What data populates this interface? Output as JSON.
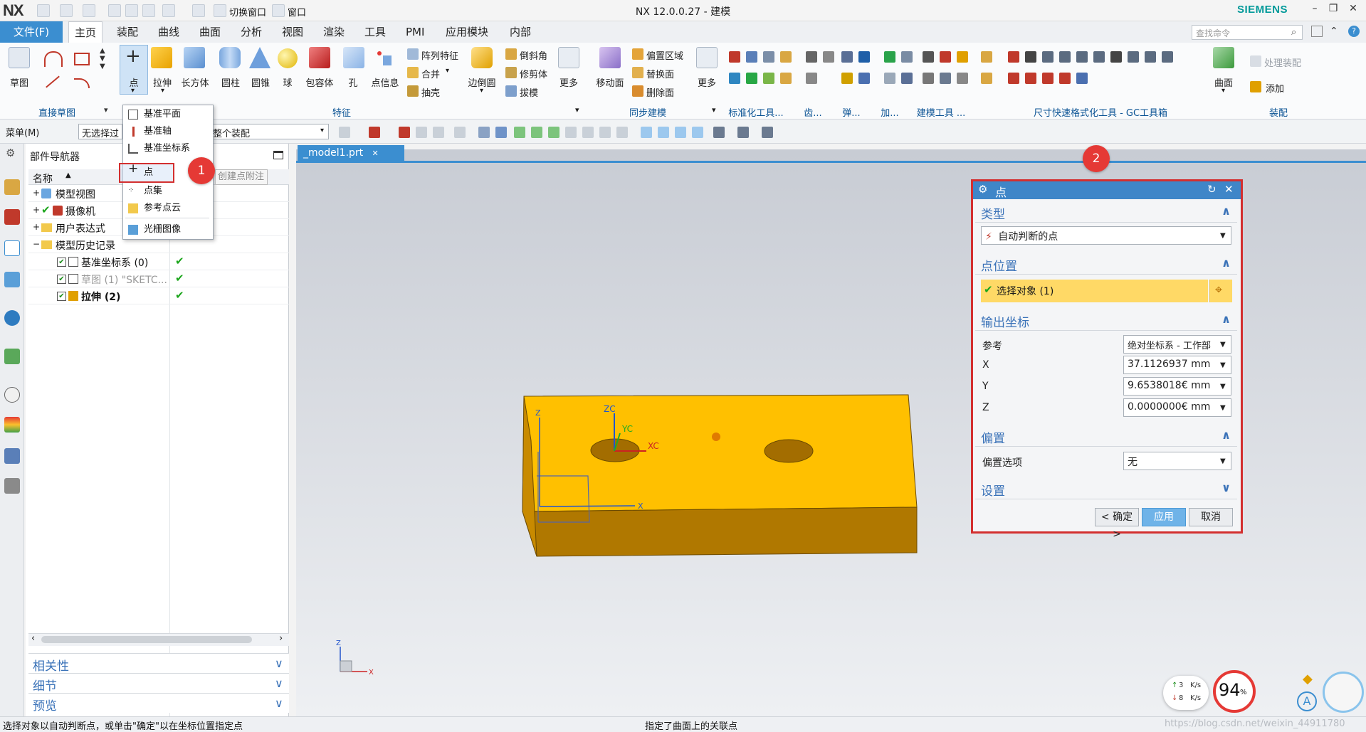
{
  "window": {
    "logo": "NX",
    "title": "NX 12.0.0.27 - 建模",
    "brand": "SIEMENS",
    "quick_access": {
      "switch_window": "切换窗口",
      "window": "窗口"
    }
  },
  "menu": {
    "file": "文件(F)",
    "tabs": [
      "主页",
      "装配",
      "曲线",
      "曲面",
      "分析",
      "视图",
      "渲染",
      "工具",
      "PMI",
      "应用模块",
      "内部"
    ],
    "search_placeholder": "查找命令"
  },
  "ribbon": {
    "sketch": "草图",
    "direct_sketch_group": "直接草图",
    "point": "点",
    "extrude": "拉伸",
    "block": "长方体",
    "cylinder": "圆柱",
    "cone": "圆锥",
    "sphere": "球",
    "bounding_body": "包容体",
    "hole": "孔",
    "point_info": "点信息",
    "pattern_feature": "阵列特征",
    "unite": "合并",
    "shell": "抽壳",
    "edge_blend": "边倒圆",
    "chamfer": "倒斜角",
    "trim_body": "修剪体",
    "draft": "拔模",
    "more": "更多",
    "feature_group": "特征",
    "move_face": "移动面",
    "offset_region": "偏置区域",
    "replace_face": "替换面",
    "delete_face": "删除面",
    "sync_group": "同步建模",
    "more2": "更多",
    "std_tools": "标准化工具...",
    "gear": "齿...",
    "spring": "弹...",
    "machining": "加...",
    "modeling_tools": "建模工具 ...",
    "dim_format": "尺寸快速格式化工具 - GC工具箱",
    "surface": "曲面",
    "assembly_group": "装配",
    "process_assembly": "处理装配",
    "add": "添加"
  },
  "selbar": {
    "menu": "菜单(M)",
    "filter": "无选择过",
    "scope": "整个装配"
  },
  "navigator": {
    "title": "部件导航器",
    "col_name": "名称",
    "rows": [
      {
        "label": "模型视图"
      },
      {
        "label": "摄像机"
      },
      {
        "label": "用户表达式"
      },
      {
        "label": "模型历史记录"
      },
      {
        "label": "基准坐标系 (0)"
      },
      {
        "label": "草图 (1) \"SKETC..."
      },
      {
        "label": "拉伸 (2)"
      }
    ],
    "panels": [
      "相关性",
      "细节",
      "预览"
    ]
  },
  "dropdown": {
    "items": [
      "基准平面",
      "基准轴",
      "基准坐标系",
      "点",
      "点集",
      "参考点云",
      "光栅图像"
    ],
    "tooltip": "创建点附注"
  },
  "badges": {
    "one": "1",
    "two": "2"
  },
  "document_tab": "_model1.prt",
  "viewport": {
    "triad": {
      "x": "X",
      "y": "Y",
      "z": "Z"
    },
    "csys": {
      "xc": "XC",
      "yc": "YC",
      "zc": "ZC"
    }
  },
  "dialog": {
    "title": "点",
    "type_section": "类型",
    "type_value": "自动判断的点",
    "location_section": "点位置",
    "select_object": "选择对象 (1)",
    "output_section": "输出坐标",
    "reference_label": "参考",
    "reference_value": "绝对坐标系 - 工作部",
    "x_label": "X",
    "x_value": "37.1126937 mm",
    "y_label": "Y",
    "y_value": "9.6538018€ mm",
    "z_label": "Z",
    "z_value": "0.0000000€ mm",
    "offset_section": "偏置",
    "offset_label": "偏置选项",
    "offset_value": "无",
    "settings_section": "设置",
    "ok": "< 确定 >",
    "apply": "应用",
    "cancel": "取消"
  },
  "netmeter": {
    "up": "3",
    "down": "8",
    "up_unit": "K/s",
    "down_unit": "K/s",
    "percent": "94",
    "percent_sign": "%",
    "up_arrow": "↑",
    "down_arrow": "↓"
  },
  "status": {
    "left": "选择对象以自动判断点，或单击\"确定\"以在坐标位置指定点",
    "center": "指定了曲面上的关联点",
    "watermark": "https://blog.csdn.net/weixin_44911780"
  },
  "colors": {
    "accent": "#3b8ed0",
    "part": "#ffc000",
    "highlight": "#d32f2f",
    "select": "#ffd966"
  }
}
